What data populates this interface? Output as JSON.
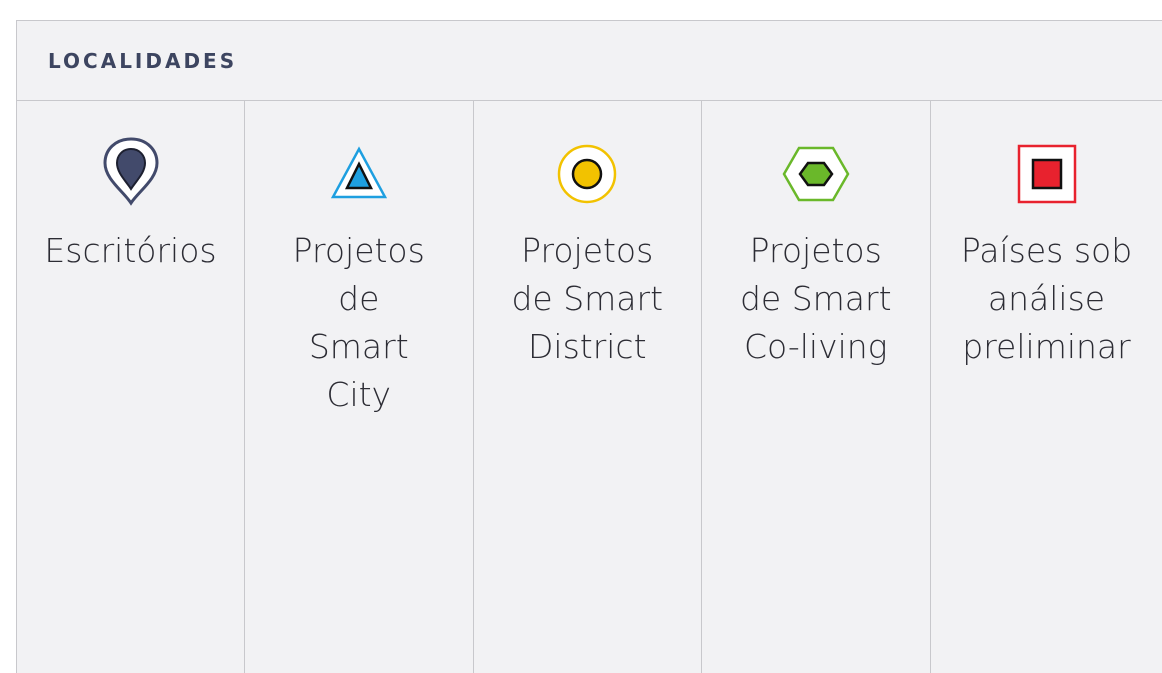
{
  "header": {
    "title": "LOCALIDADES"
  },
  "legend": {
    "items": [
      {
        "label": "Escritórios",
        "icon": "map-pin-icon",
        "color": "#424a6b"
      },
      {
        "label": "Projetos\nde\nSmart\nCity",
        "icon": "triangle-icon",
        "color": "#1e9fe0"
      },
      {
        "label": "Projetos\nde Smart\nDistrict",
        "icon": "circle-icon",
        "color": "#f2c200"
      },
      {
        "label": "Projetos\nde Smart\nCo-living",
        "icon": "hexagon-icon",
        "color": "#6ab82a"
      },
      {
        "label": "Países sob\nanálise\npreliminar",
        "icon": "square-icon",
        "color": "#e8222e"
      }
    ]
  }
}
